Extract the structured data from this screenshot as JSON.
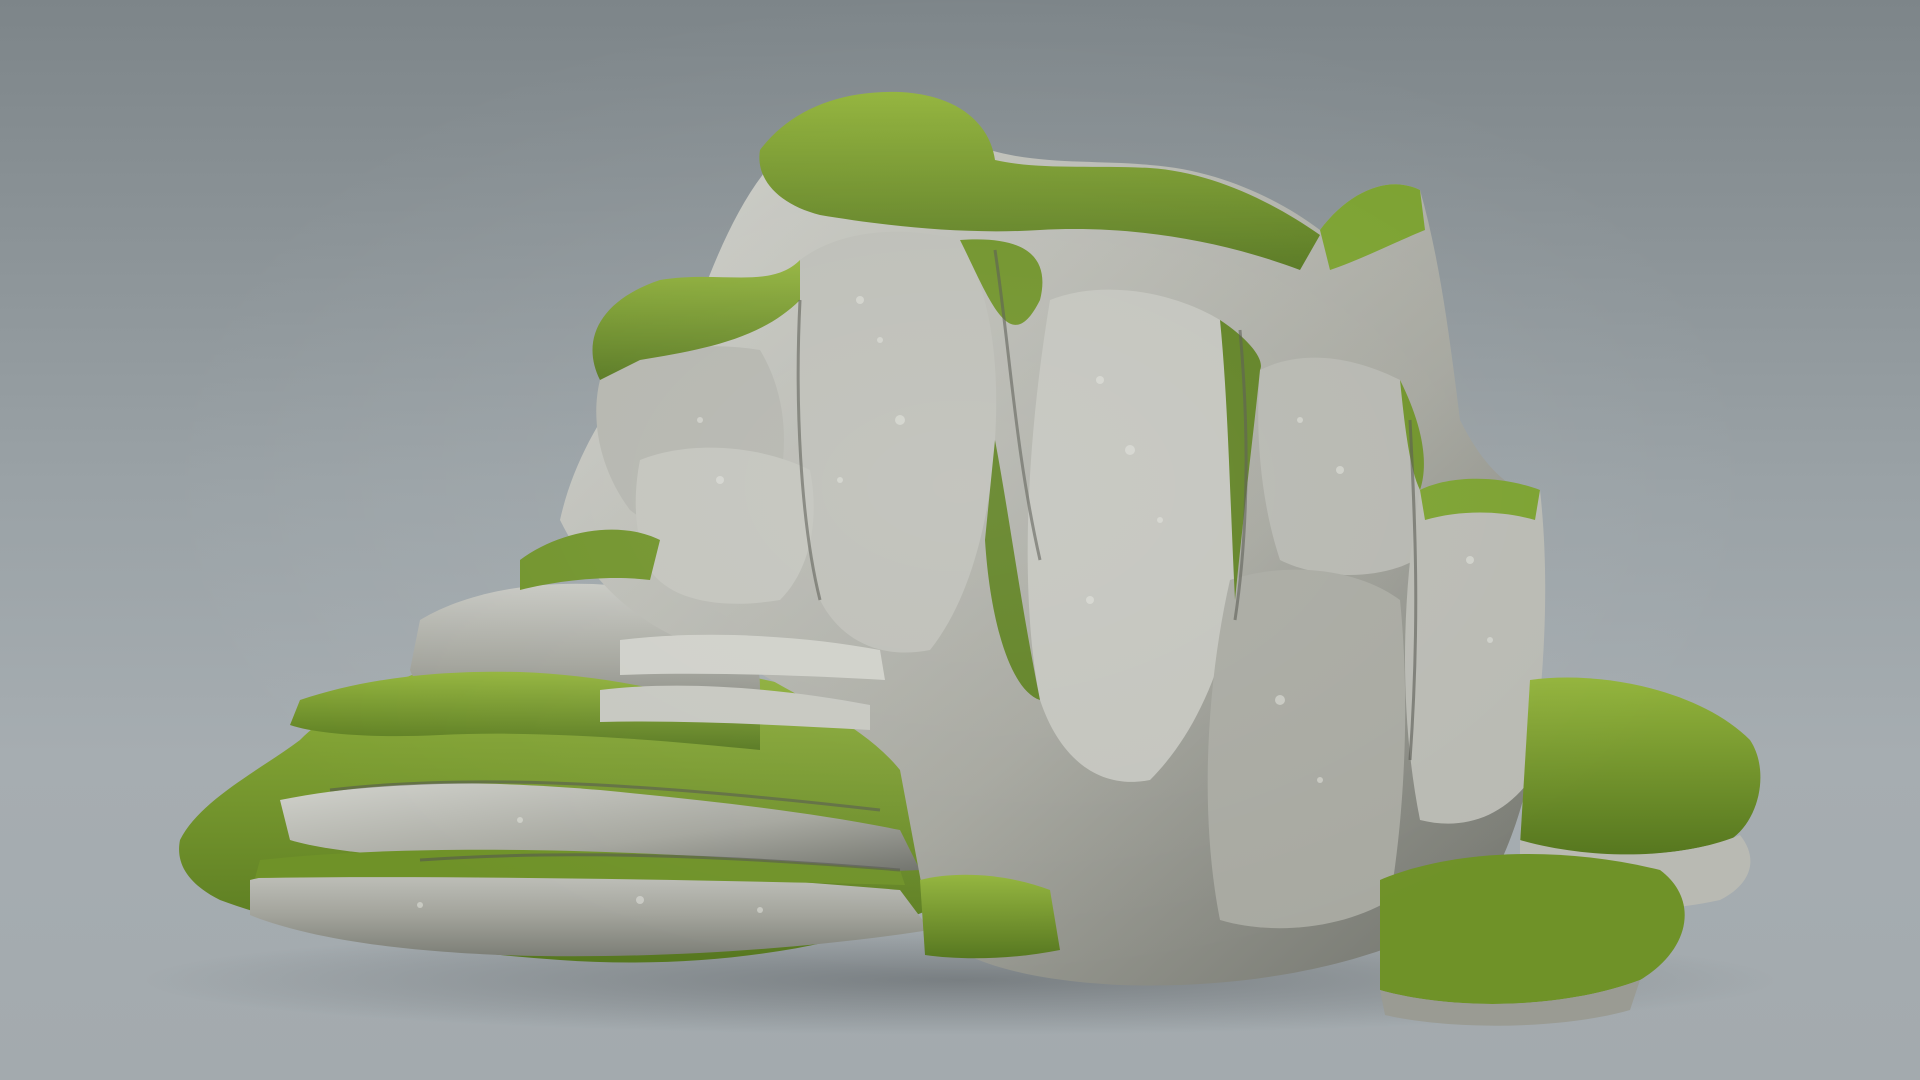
{
  "scene": {
    "subject": "rock-model",
    "colors": {
      "background_top": "#7d8589",
      "background_bottom": "#a3aaae",
      "rock_light": "#c9cac4",
      "rock_mid": "#9a9b93",
      "rock_dark": "#5d5f58",
      "moss_light": "#8fb03a",
      "moss_mid": "#6f9228",
      "moss_dark": "#43601a"
    }
  }
}
